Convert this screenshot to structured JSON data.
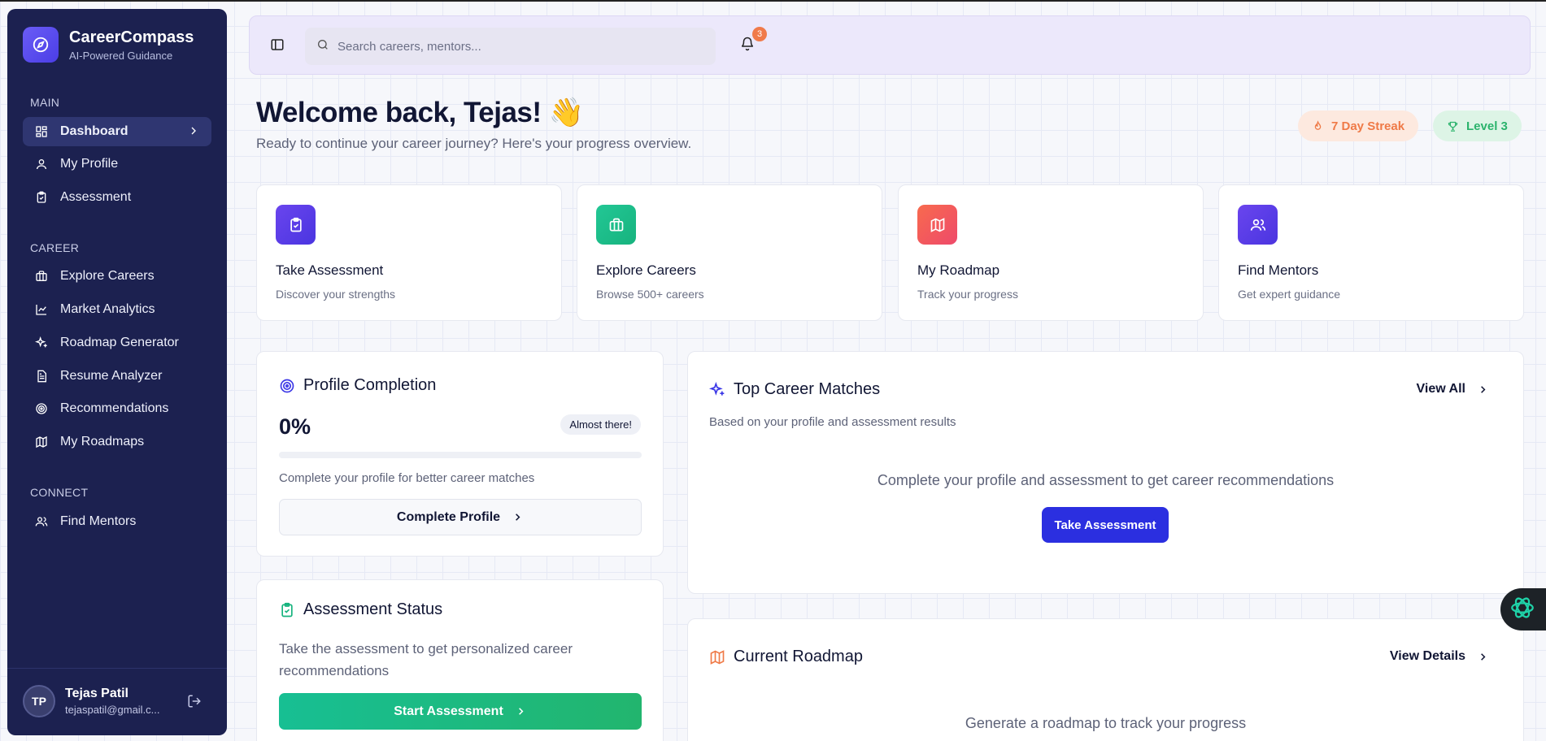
{
  "brand": {
    "name": "CareerCompass",
    "subtitle": "AI-Powered Guidance"
  },
  "sidebar": {
    "sections": [
      {
        "title": "MAIN"
      },
      {
        "title": "CAREER"
      },
      {
        "title": "CONNECT"
      }
    ],
    "items": [
      {
        "label": "Dashboard",
        "icon": "dashboard-icon",
        "active": true
      },
      {
        "label": "My Profile",
        "icon": "user-icon"
      },
      {
        "label": "Assessment",
        "icon": "clipboard-check-icon"
      },
      {
        "label": "Explore Careers",
        "icon": "briefcase-icon"
      },
      {
        "label": "Market Analytics",
        "icon": "line-chart-icon"
      },
      {
        "label": "Roadmap Generator",
        "icon": "sparkles-icon"
      },
      {
        "label": "Resume Analyzer",
        "icon": "document-icon"
      },
      {
        "label": "Recommendations",
        "icon": "target-icon"
      },
      {
        "label": "My Roadmaps",
        "icon": "map-icon"
      },
      {
        "label": "Find Mentors",
        "icon": "users-icon"
      }
    ]
  },
  "user": {
    "initials": "TP",
    "name": "Tejas Patil",
    "email": "tejaspatil@gmail.c..."
  },
  "header": {
    "search_placeholder": "Search careers, mentors...",
    "notification_count": "3"
  },
  "welcome": {
    "title": "Welcome back, Tejas! 👋",
    "subtitle": "Ready to continue your career journey? Here's your progress overview.",
    "streak": "7 Day Streak",
    "level": "Level 3"
  },
  "quick_actions": [
    {
      "title": "Take Assessment",
      "subtitle": "Discover your strengths",
      "color": "#5b3fe8"
    },
    {
      "title": "Explore Careers",
      "subtitle": "Browse 500+ careers",
      "color": "#1fbf8a"
    },
    {
      "title": "My Roadmap",
      "subtitle": "Track your progress",
      "color": "#f0595e"
    },
    {
      "title": "Find Mentors",
      "subtitle": "Get expert guidance",
      "color": "#5a3ce6"
    }
  ],
  "profile_completion": {
    "title": "Profile Completion",
    "percent_label": "0%",
    "progress": 0,
    "badge": "Almost there!",
    "description": "Complete your profile for better career matches",
    "button": "Complete Profile"
  },
  "assessment_status": {
    "title": "Assessment Status",
    "description": "Take the assessment to get personalized career recommendations",
    "button": "Start Assessment"
  },
  "top_matches": {
    "title": "Top Career Matches",
    "subtitle": "Based on your profile and assessment results",
    "link": "View All",
    "empty_message": "Complete your profile and assessment to get career recommendations",
    "button": "Take Assessment"
  },
  "current_roadmap": {
    "title": "Current Roadmap",
    "link": "View Details",
    "empty_message": "Generate a roadmap to track your progress"
  },
  "colors": {
    "accent": "#2b2fe0",
    "sidebar": "#1c2150",
    "streak": "#ef7a47",
    "level": "#2bb36c"
  }
}
